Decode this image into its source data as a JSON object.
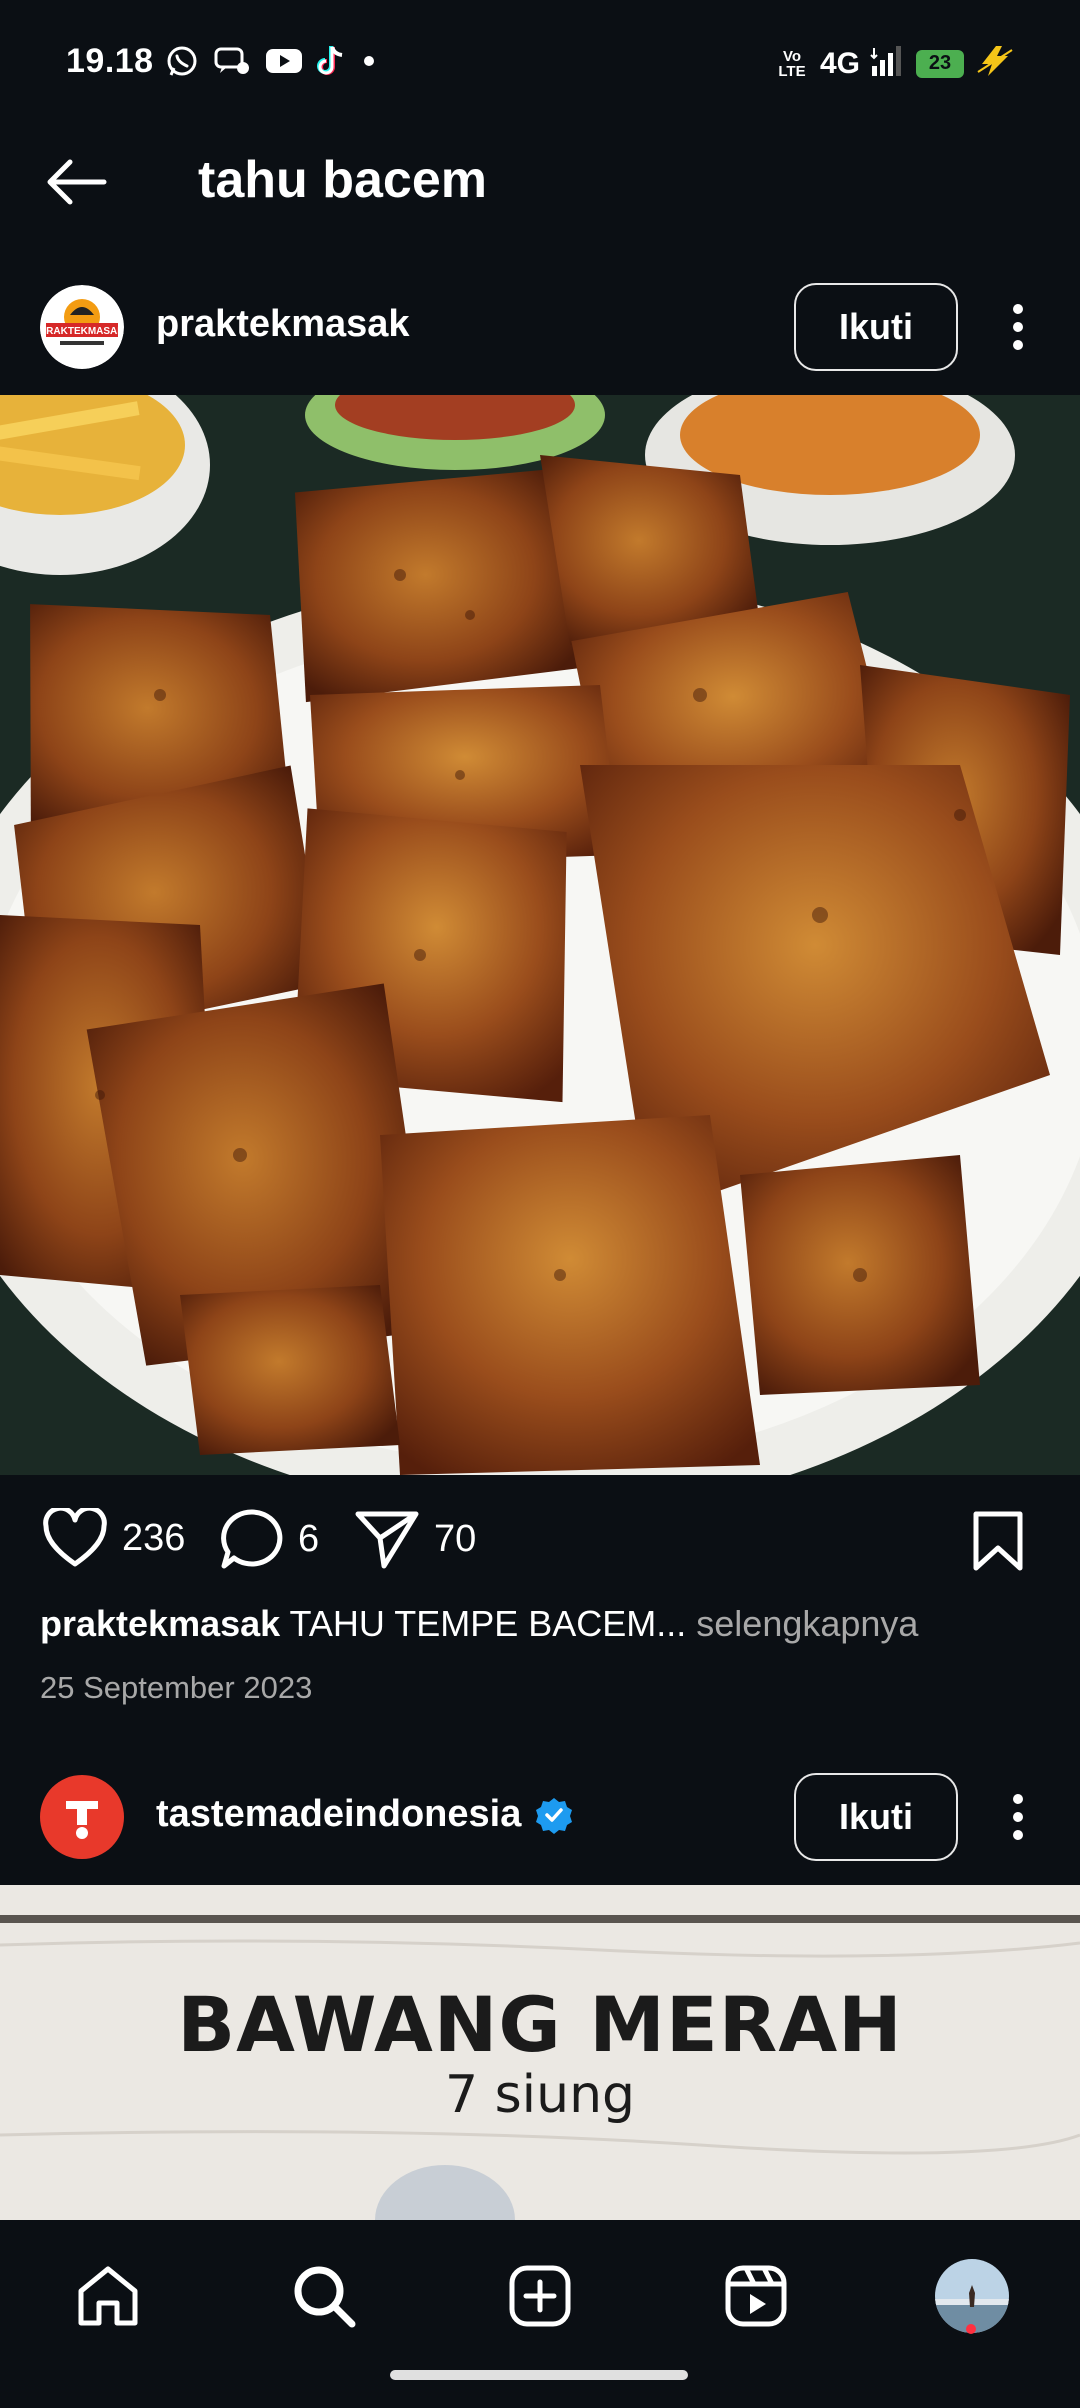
{
  "status_bar": {
    "time": "19.18",
    "volte": "Vo LTE",
    "network": "4G",
    "battery": "23",
    "icons": [
      "whatsapp-icon",
      "chat-icon",
      "youtube-icon",
      "tiktok-icon",
      "dot-icon",
      "signal-icon",
      "charging-icon"
    ]
  },
  "header": {
    "title": "tahu bacem",
    "back_icon": "arrow-left-icon"
  },
  "posts": [
    {
      "username": "praktekmasak",
      "avatar_text": "PRAKTEKMASAK",
      "verified": false,
      "follow_label": "Ikuti",
      "likes": "236",
      "comments": "6",
      "shares": "70",
      "caption_user": "praktekmasak",
      "caption_text": "TAHU TEMPE BACEM...",
      "caption_more": "selengkapnya",
      "date": "25 September 2023"
    },
    {
      "username": "tastemadeindonesia",
      "verified": true,
      "follow_label": "Ikuti",
      "image_title": "BAWANG MERAH",
      "image_subtitle": "7 siung"
    }
  ],
  "bottom_nav": {
    "items": [
      "home-icon",
      "search-icon",
      "create-icon",
      "reels-icon",
      "profile-avatar"
    ]
  },
  "colors": {
    "background": "#0b0f14",
    "text": "#ffffff",
    "muted": "#a8a8a8",
    "verified": "#1d9bf0",
    "tastemade_red": "#e8392b",
    "battery": "#4caf50",
    "notification_dot": "#ff3040"
  }
}
